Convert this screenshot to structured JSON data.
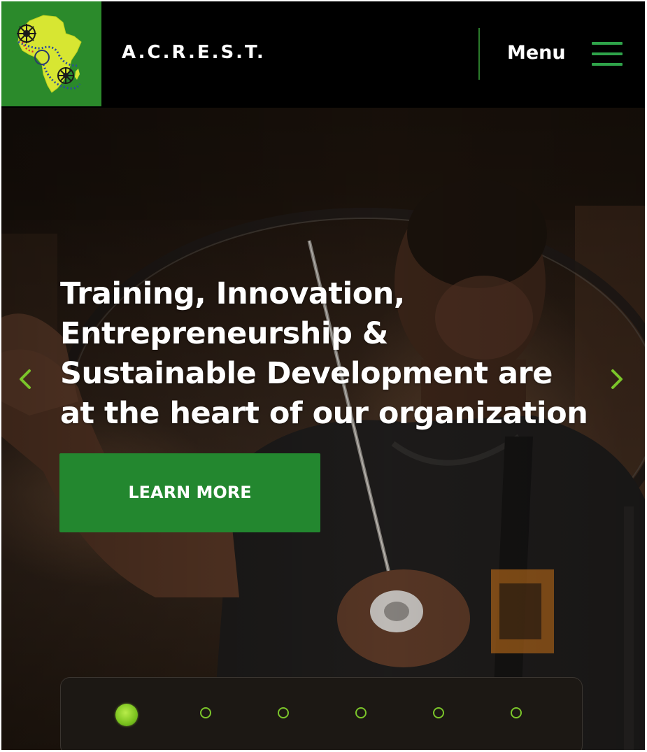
{
  "header": {
    "brand": "A.C.R.E.S.T.",
    "menu_label": "Menu",
    "icons": [
      "africa-logo",
      "hamburger-icon"
    ]
  },
  "hero": {
    "headline": "Training, Innovation, Entrepreneurship & Sustainable Development are at the heart of our organization",
    "cta_label": "LEARN MORE",
    "arrows": [
      "chevron-left-icon",
      "chevron-right-icon"
    ]
  },
  "slider": {
    "slide_count": 6,
    "active_index": 0
  },
  "colors": {
    "brand_green": "#23872f",
    "logo_bg": "#2b8a2b",
    "africa_yellow": "#d7e632",
    "accent_lime": "#7bc52a",
    "header_bg": "#000000"
  }
}
